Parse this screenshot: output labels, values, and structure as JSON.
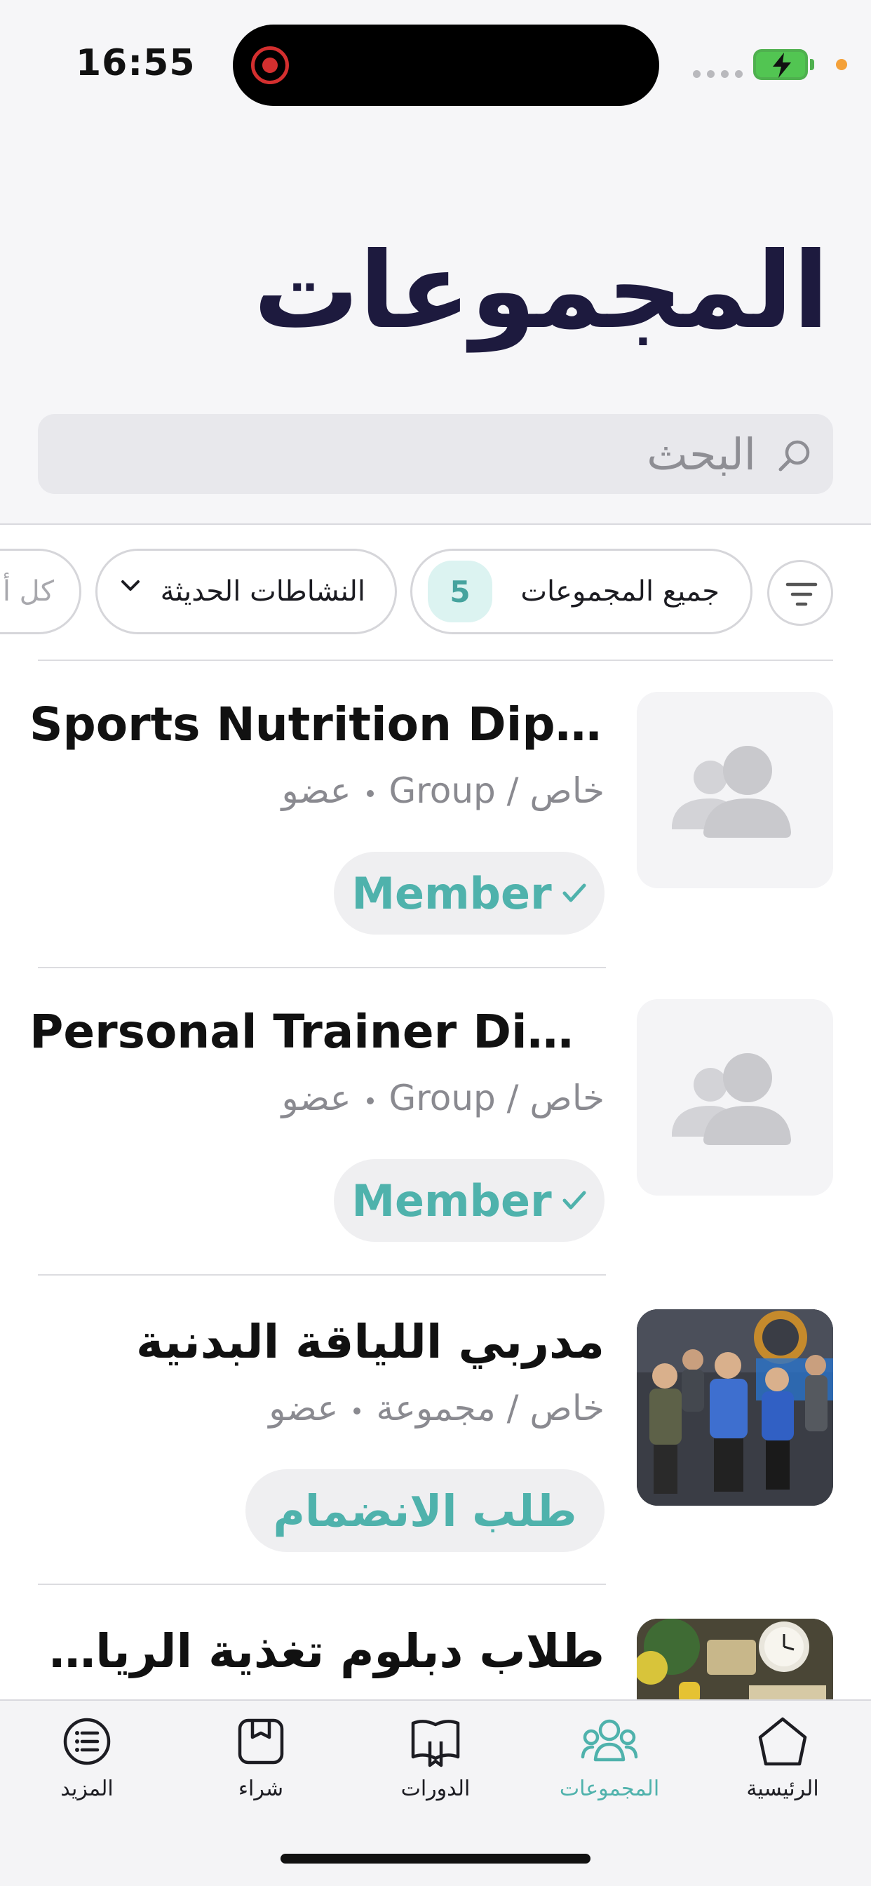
{
  "status_bar": {
    "time": "16:55"
  },
  "header": {
    "title": "المجموعات"
  },
  "search": {
    "placeholder": "البحث"
  },
  "filters": {
    "all_groups_label": "جميع المجموعات",
    "all_groups_count": "5",
    "recent_activity_label": "النشاطات الحديثة",
    "third_chip_partial": "كل أ"
  },
  "groups": [
    {
      "title": "Sports Nutrition Diplo...",
      "privacy": "خاص / Group",
      "role": "عضو",
      "action": "Member"
    },
    {
      "title": "Personal Trainer Diplo...",
      "privacy": "خاص / Group",
      "role": "عضو",
      "action": "Member"
    },
    {
      "title": "مدربي اللياقة البدنية",
      "privacy": "خاص / مجموعة",
      "role": "عضو",
      "action": "طلب الانضمام"
    },
    {
      "title": "طلاب دبلوم تغذية الرياضي..."
    }
  ],
  "tabbar": {
    "home": "الرئيسية",
    "groups": "المجموعات",
    "courses": "الدورات",
    "shop": "شراء",
    "more": "المزيد"
  },
  "colors": {
    "accent": "#4fb2ac",
    "title": "#1d1a3e",
    "muted": "#8a8a90"
  },
  "icons": [
    "search-icon",
    "filter-icon",
    "chevron-down-icon",
    "group-placeholder-icon",
    "check-icon",
    "home-icon",
    "groups-icon",
    "courses-icon",
    "shop-icon",
    "more-icon"
  ]
}
